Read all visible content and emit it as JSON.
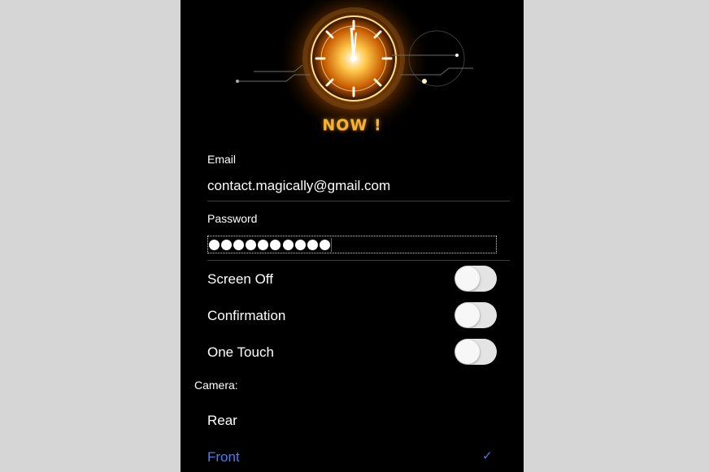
{
  "hero": {
    "title": "NOW !"
  },
  "email": {
    "label": "Email",
    "value": "contact.magically@gmail.com"
  },
  "password": {
    "label": "Password",
    "masked_length": 10
  },
  "settings": [
    {
      "label": "Screen Off",
      "enabled": false
    },
    {
      "label": "Confirmation",
      "enabled": false
    },
    {
      "label": "One Touch",
      "enabled": false
    }
  ],
  "camera": {
    "label": "Camera:",
    "options": [
      {
        "label": "Rear",
        "selected": false
      },
      {
        "label": "Front",
        "selected": true
      }
    ],
    "check_glyph": "✓"
  },
  "colors": {
    "background": "#000000",
    "accent": "#4a7df0",
    "toggle_off": "#e4e4e4",
    "hero_gold": "#f2b233"
  },
  "icons": {
    "checkmark": "checkmark-icon",
    "hero": "clock-emblem-icon"
  }
}
